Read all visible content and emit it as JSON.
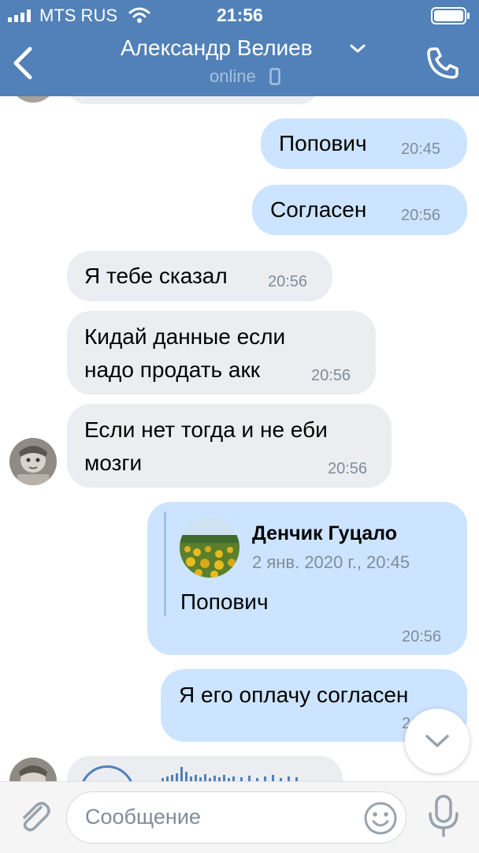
{
  "status": {
    "carrier": "MTS RUS",
    "time": "21:56"
  },
  "header": {
    "contact_name": "Александр Велиев",
    "presence": "online"
  },
  "messages": [
    {
      "direction": "out",
      "text": "Попович",
      "time": "20:45"
    },
    {
      "direction": "out",
      "text": "Согласен",
      "time": "20:56"
    },
    {
      "direction": "in",
      "text": "Я тебе сказал",
      "time": "20:56"
    },
    {
      "direction": "in",
      "lines": [
        "Кидай данные если",
        "надо продать акк"
      ],
      "time": "20:56"
    },
    {
      "direction": "in",
      "lines": [
        "Если нет тогда и не еби",
        "мозги"
      ],
      "time": "20:56"
    },
    {
      "direction": "out",
      "forwarded": {
        "author": "Денчик Гуцало",
        "date": "2 янв. 2020 г., 20:45",
        "text": "Попович"
      },
      "time": "20:56"
    },
    {
      "direction": "out",
      "text": "Я его оплачу согласен",
      "time": "2"
    }
  ],
  "composer": {
    "placeholder": "Сообщение"
  },
  "colors": {
    "header": "#5181b8",
    "outgoing_bubble": "#cce4ff",
    "incoming_bubble": "#ebedf0",
    "timestamp": "#818c99"
  },
  "icons": [
    "signal-bars-icon",
    "wifi-icon",
    "battery-icon",
    "back-chevron-icon",
    "chevron-down-icon",
    "phone-icon",
    "mobile-device-icon",
    "scroll-down-icon",
    "attach-icon",
    "emoji-icon",
    "mic-icon",
    "play-icon"
  ]
}
